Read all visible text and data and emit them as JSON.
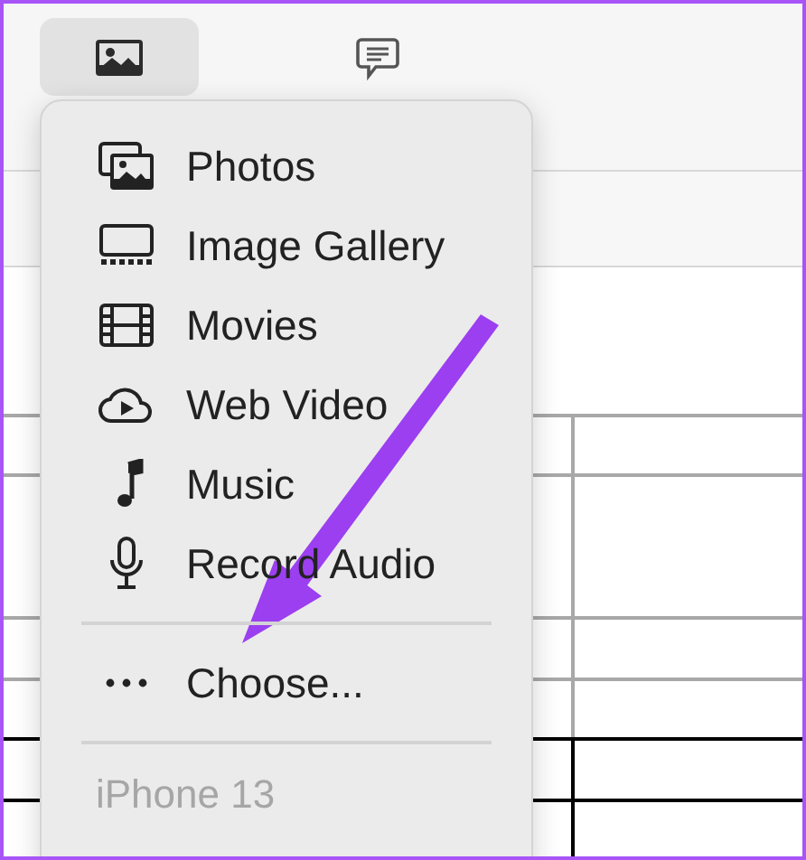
{
  "toolbar": {
    "buttons": [
      {
        "kind": "media",
        "selected": true
      },
      {
        "kind": "comment",
        "selected": false
      }
    ]
  },
  "menu": {
    "items": [
      {
        "kind": "photos",
        "label": "Photos"
      },
      {
        "kind": "gallery",
        "label": "Image Gallery"
      },
      {
        "kind": "movies",
        "label": "Movies"
      },
      {
        "kind": "webvideo",
        "label": "Web Video"
      },
      {
        "kind": "music",
        "label": "Music"
      },
      {
        "kind": "audio",
        "label": "Record Audio"
      },
      {
        "kind": "separator"
      },
      {
        "kind": "choose",
        "label": "Choose..."
      },
      {
        "kind": "separator"
      },
      {
        "kind": "header",
        "label": "iPhone 13"
      }
    ]
  }
}
